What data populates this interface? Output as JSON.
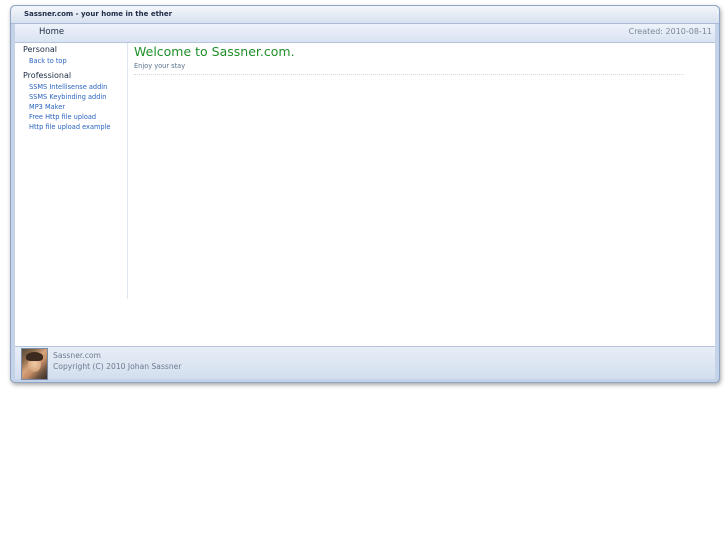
{
  "window": {
    "title": "Sassner.com - your home in the ether"
  },
  "navbar": {
    "home_label": "Home",
    "created_text": "Created: 2010-08-11"
  },
  "sidebar": {
    "personal": {
      "heading": "Personal",
      "items": [
        "Back to top"
      ]
    },
    "professional": {
      "heading": "Professional",
      "items": [
        "SSMS Intellisense addin",
        "SSMS Keybinding addin",
        "MP3 Maker",
        "Free Http file upload",
        "Http file upload example"
      ]
    }
  },
  "main": {
    "heading": "Welcome to Sassner.com.",
    "subheading": "Enjoy your stay"
  },
  "footer": {
    "site": "Sassner.com",
    "copyright": "Copyright (C) 2010 Johan Sassner"
  },
  "colors": {
    "heading": "#1f8f2a",
    "link": "#2a64c0",
    "frame": "#c5d3e8"
  }
}
